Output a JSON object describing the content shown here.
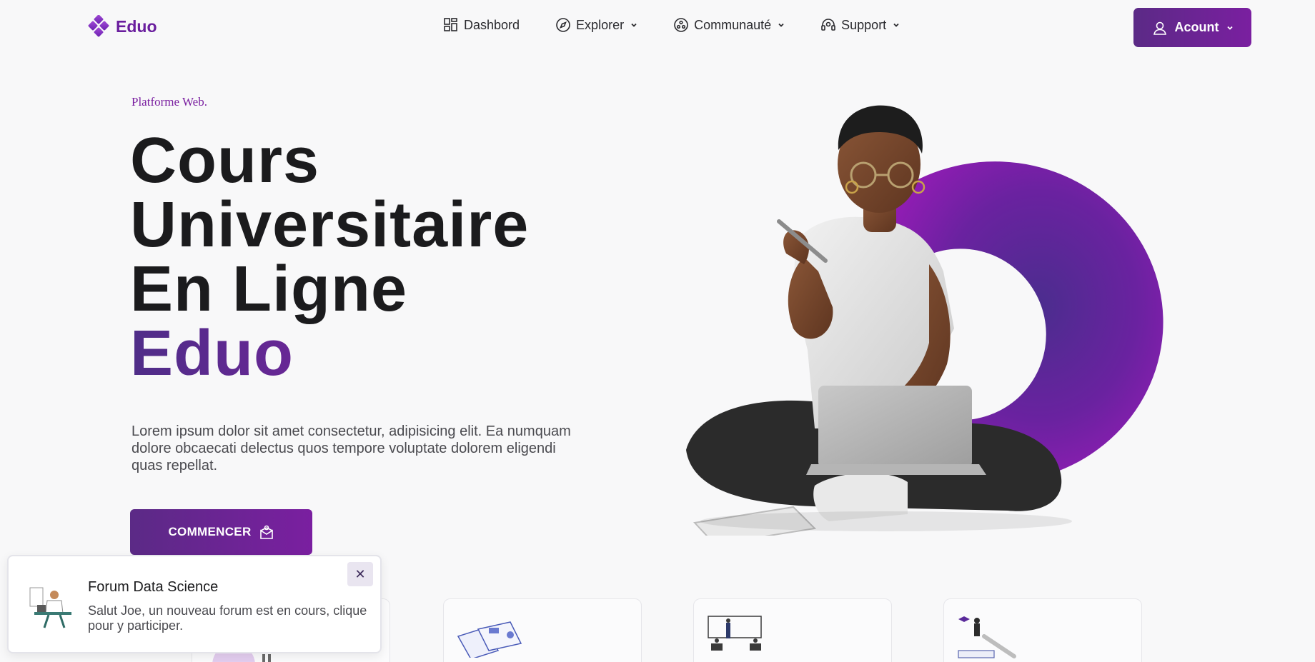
{
  "brand": {
    "name": "Eduo",
    "logo_icon": "diamond-cluster-icon",
    "accent_color": "#6a1e9e",
    "gradient_start": "#5b2a86",
    "gradient_end": "#7a1fa0"
  },
  "nav": {
    "items": [
      {
        "label": "Dashbord",
        "icon": "dashboard-grid-icon",
        "has_dropdown": false
      },
      {
        "label": "Explorer",
        "icon": "compass-icon",
        "has_dropdown": true
      },
      {
        "label": "Communauté",
        "icon": "community-circles-icon",
        "has_dropdown": true
      },
      {
        "label": "Support",
        "icon": "headset-icon",
        "has_dropdown": true
      }
    ],
    "account_label": "Acount",
    "account_icon": "user-icon"
  },
  "hero": {
    "eyebrow": "Platforme Web.",
    "title_lines": [
      "Cours",
      "Universitaire",
      "En Ligne"
    ],
    "title_brand": "Eduo",
    "description": "Lorem ipsum dolor sit amet consectetur, adipisicing elit. Ea numquam dolore obcaecati delectus quos tempore voluptate dolorem eligendi quas repellat.",
    "cta_label": "COMMENCER",
    "cta_icon": "reader-box-icon"
  },
  "cards": [
    {
      "icon": "purple-blob-illustration"
    },
    {
      "icon": "documents-charts-illustration"
    },
    {
      "icon": "classroom-whiteboard-illustration"
    },
    {
      "icon": "graduate-books-illustration"
    }
  ],
  "toast": {
    "title": "Forum Data Science",
    "body": "Salut Joe, un nouveau forum est en cours, clique pour y participer.",
    "close_symbol": "✕"
  }
}
